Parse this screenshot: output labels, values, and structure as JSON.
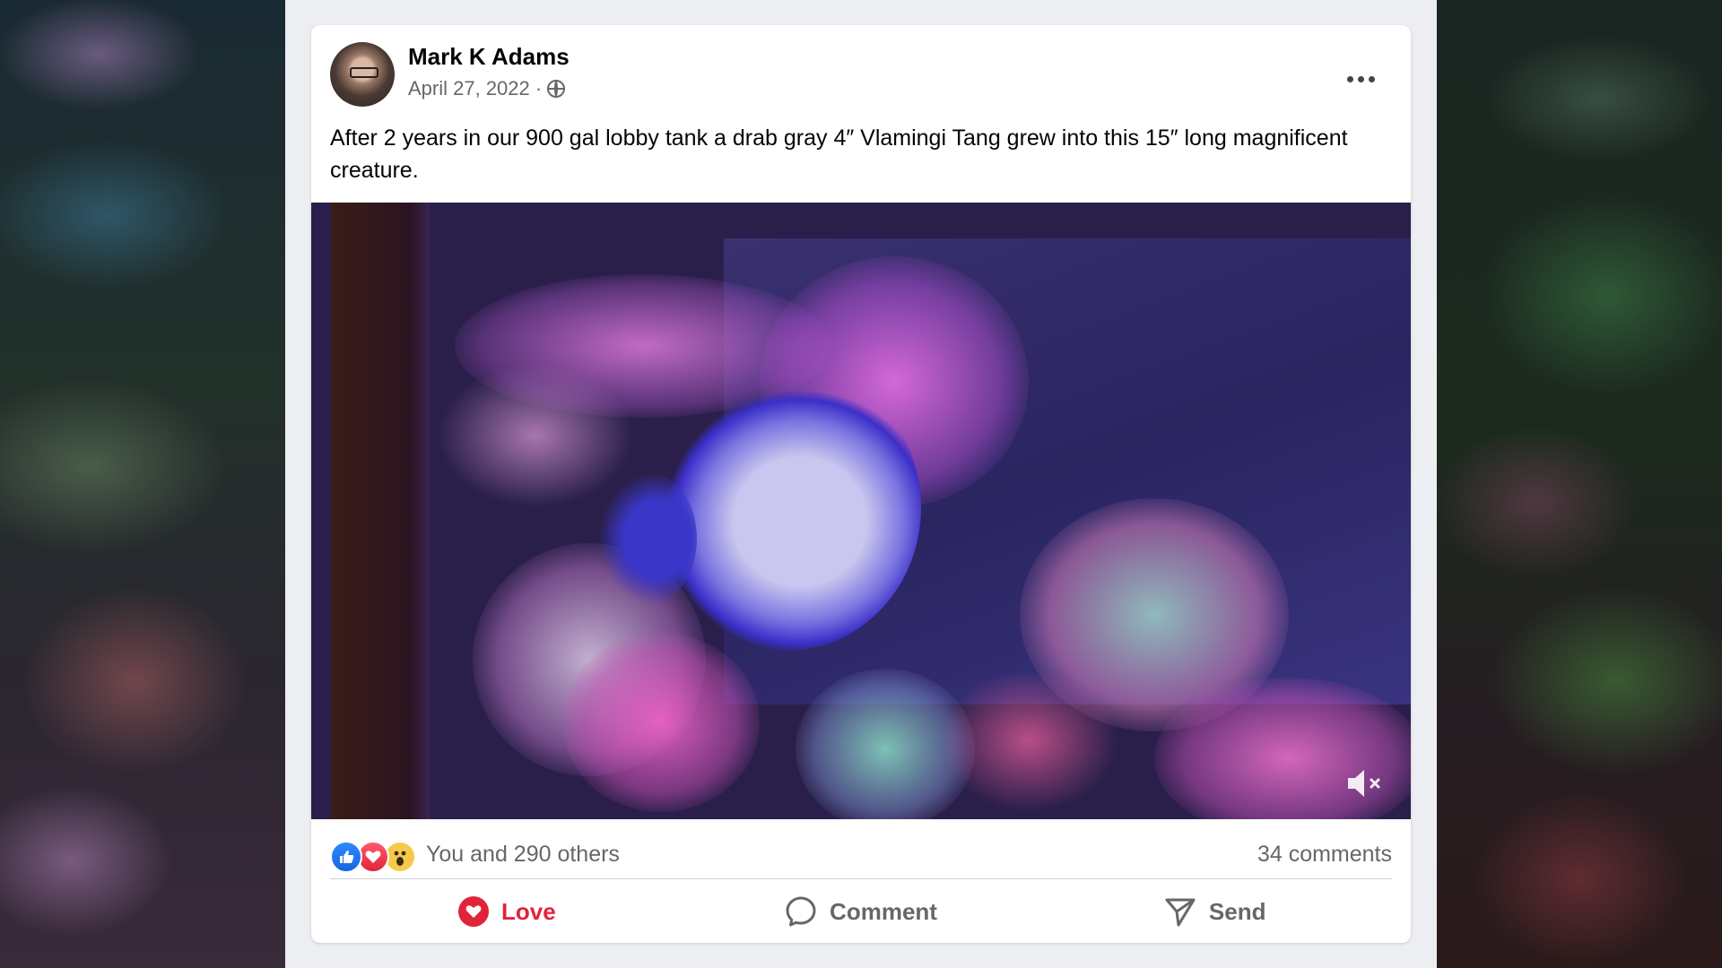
{
  "post": {
    "author": "Mark K Adams",
    "date": "April 27, 2022 ·",
    "privacy_icon": "globe-icon",
    "text": "After 2 years in our 900 gal lobby tank a drab gray 4″ Vlamingi Tang grew into this 15″ long magnificent creature."
  },
  "video": {
    "muted": true,
    "mute_icon": "speaker-muted-icon"
  },
  "reactions": {
    "types": [
      "like",
      "love",
      "wow"
    ],
    "summary": "You and 290 others",
    "comments": "34 comments"
  },
  "actions": {
    "love_label": "Love",
    "comment_label": "Comment",
    "send_label": "Send"
  },
  "colors": {
    "love_red": "#e0243a",
    "like_blue": "#1666e0",
    "wow_yellow": "#f7c94a",
    "secondary_text": "#65676b",
    "feed_background": "#eceef1"
  }
}
